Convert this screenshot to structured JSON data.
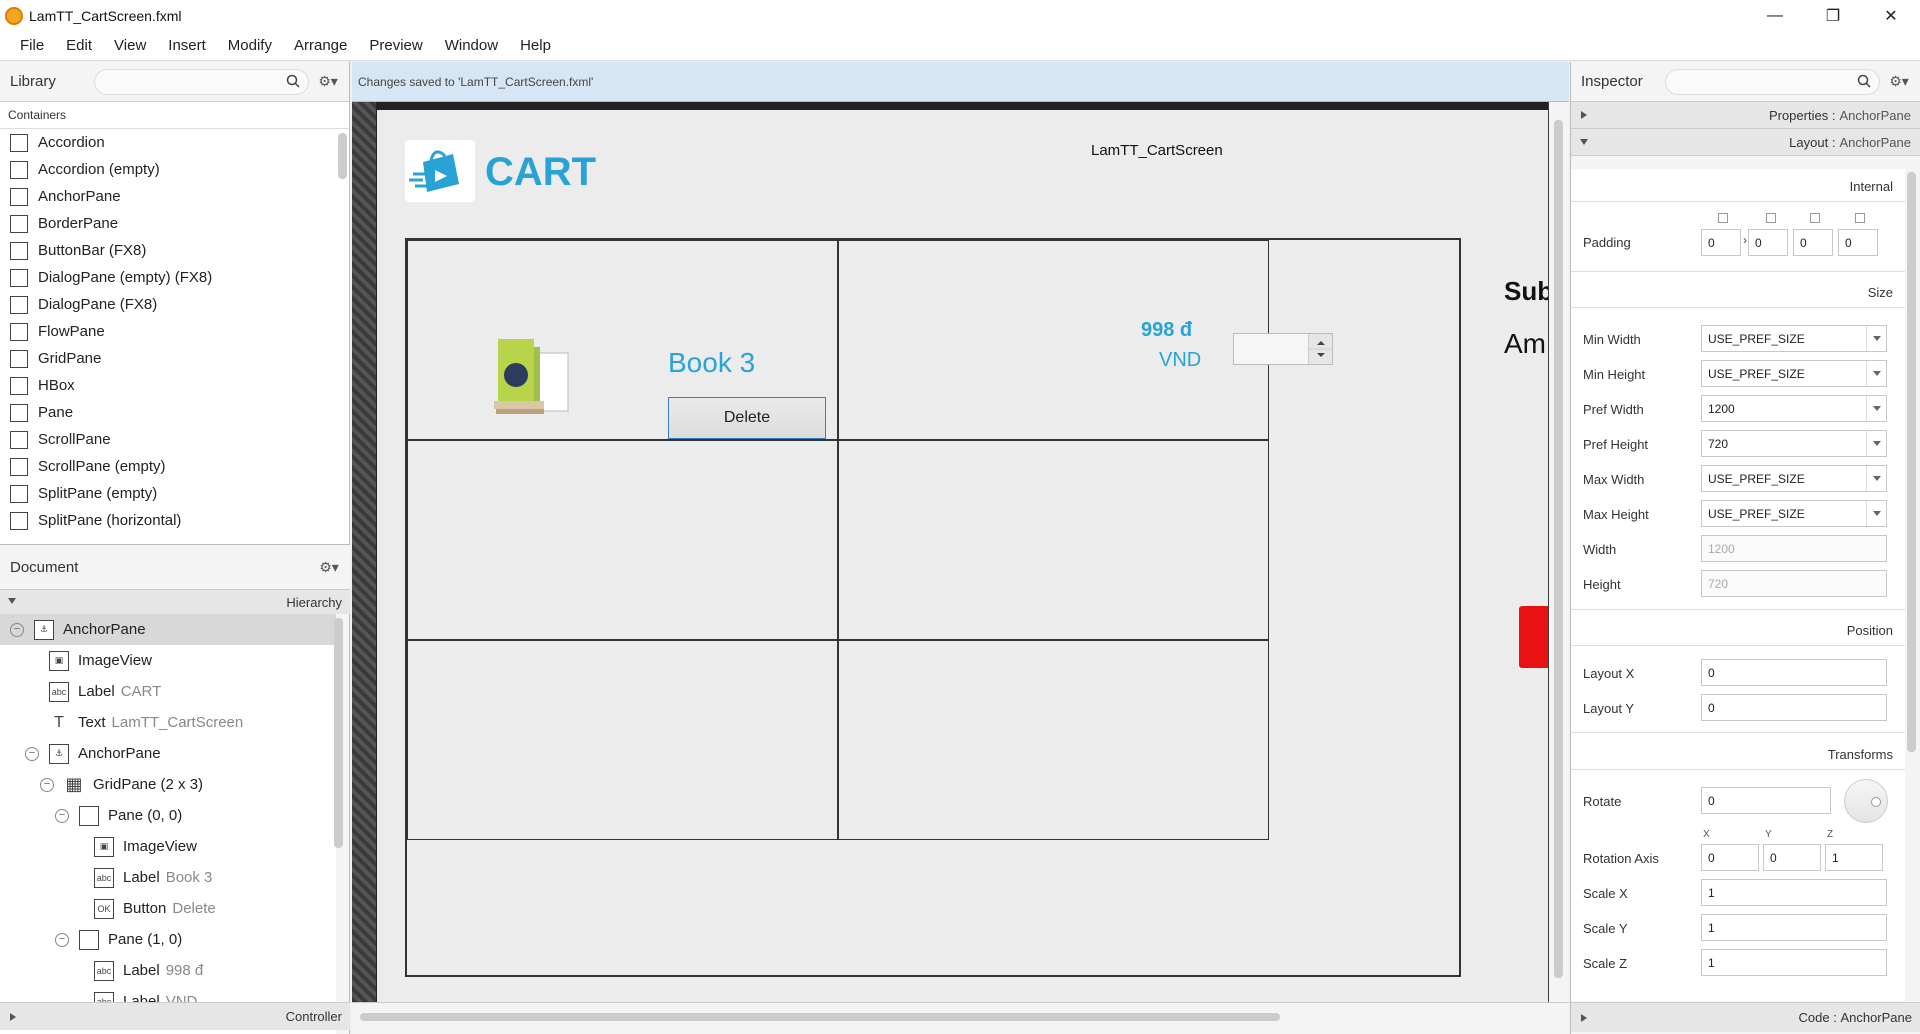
{
  "window": {
    "title": "LamTT_CartScreen.fxml",
    "minimize": "—",
    "restore": "❐",
    "close": "✕"
  },
  "menu": [
    "File",
    "Edit",
    "View",
    "Insert",
    "Modify",
    "Arrange",
    "Preview",
    "Window",
    "Help"
  ],
  "library": {
    "title": "Library",
    "section": "Containers",
    "items": [
      "Accordion",
      "Accordion  (empty)",
      "AnchorPane",
      "BorderPane",
      "ButtonBar  (FX8)",
      "DialogPane (empty)  (FX8)",
      "DialogPane  (FX8)",
      "FlowPane",
      "GridPane",
      "HBox",
      "Pane",
      "ScrollPane",
      "ScrollPane  (empty)",
      "SplitPane  (empty)",
      "SplitPane  (horizontal)"
    ]
  },
  "document": {
    "title": "Document",
    "hierarchy_label": "Hierarchy",
    "controller_label": "Controller",
    "tree": [
      {
        "name": "AnchorPane",
        "sub": "",
        "badge": "⚓"
      },
      {
        "name": "ImageView",
        "sub": "",
        "badge": "▣"
      },
      {
        "name": "Label",
        "sub": "CART",
        "badge": "abc"
      },
      {
        "name": "Text",
        "sub": "LamTT_CartScreen",
        "badge": "T"
      },
      {
        "name": "AnchorPane",
        "sub": "",
        "badge": "⚓"
      },
      {
        "name": "GridPane (2 x 3)",
        "sub": "",
        "badge": "▦"
      },
      {
        "name": "Pane (0, 0)",
        "sub": "",
        "badge": ""
      },
      {
        "name": "ImageView",
        "sub": "",
        "badge": "▣"
      },
      {
        "name": "Label",
        "sub": "Book 3",
        "badge": "abc"
      },
      {
        "name": "Button",
        "sub": "Delete",
        "badge": "OK"
      },
      {
        "name": "Pane (1, 0)",
        "sub": "",
        "badge": ""
      },
      {
        "name": "Label",
        "sub": "998 đ",
        "badge": "abc"
      },
      {
        "name": "Label",
        "sub": "VND",
        "badge": "abc"
      }
    ]
  },
  "status": {
    "message": "Changes saved to 'LamTT_CartScreen.fxml'"
  },
  "canvas": {
    "cart_title": "CART",
    "screen_text": "LamTT_CartScreen",
    "book_label": "Book 3",
    "delete_button": "Delete",
    "price": "998 đ",
    "currency": "VND",
    "subtotal_partial": "Sub",
    "amount_partial": "Am"
  },
  "inspector": {
    "title": "Inspector",
    "properties_bar": {
      "label": "Properties",
      "target": "AnchorPane"
    },
    "layout_bar": {
      "label": "Layout",
      "target": "AnchorPane"
    },
    "code_bar": {
      "label": "Code",
      "target": "AnchorPane"
    },
    "groups": {
      "internal": "Internal",
      "size": "Size",
      "position": "Position",
      "transforms": "Transforms"
    },
    "padding": {
      "label": "Padding",
      "values": [
        "0",
        "0",
        "0",
        "0"
      ]
    },
    "size_rows": [
      {
        "label": "Min Width",
        "value": "USE_PREF_SIZE"
      },
      {
        "label": "Min Height",
        "value": "USE_PREF_SIZE"
      },
      {
        "label": "Pref Width",
        "value": "1200"
      },
      {
        "label": "Pref Height",
        "value": "720"
      },
      {
        "label": "Max Width",
        "value": "USE_PREF_SIZE"
      },
      {
        "label": "Max Height",
        "value": "USE_PREF_SIZE"
      }
    ],
    "width": {
      "label": "Width",
      "value": "1200"
    },
    "height": {
      "label": "Height",
      "value": "720"
    },
    "layout_x": {
      "label": "Layout X",
      "value": "0"
    },
    "layout_y": {
      "label": "Layout Y",
      "value": "0"
    },
    "rotate": {
      "label": "Rotate",
      "value": "0"
    },
    "axis_labels": [
      "X",
      "Y",
      "Z"
    ],
    "rotation_axis": {
      "label": "Rotation Axis",
      "values": [
        "0",
        "0",
        "1"
      ]
    },
    "scale_x": {
      "label": "Scale X",
      "value": "1"
    },
    "scale_y": {
      "label": "Scale Y",
      "value": "1"
    },
    "scale_z": {
      "label": "Scale Z",
      "value": "1"
    }
  }
}
